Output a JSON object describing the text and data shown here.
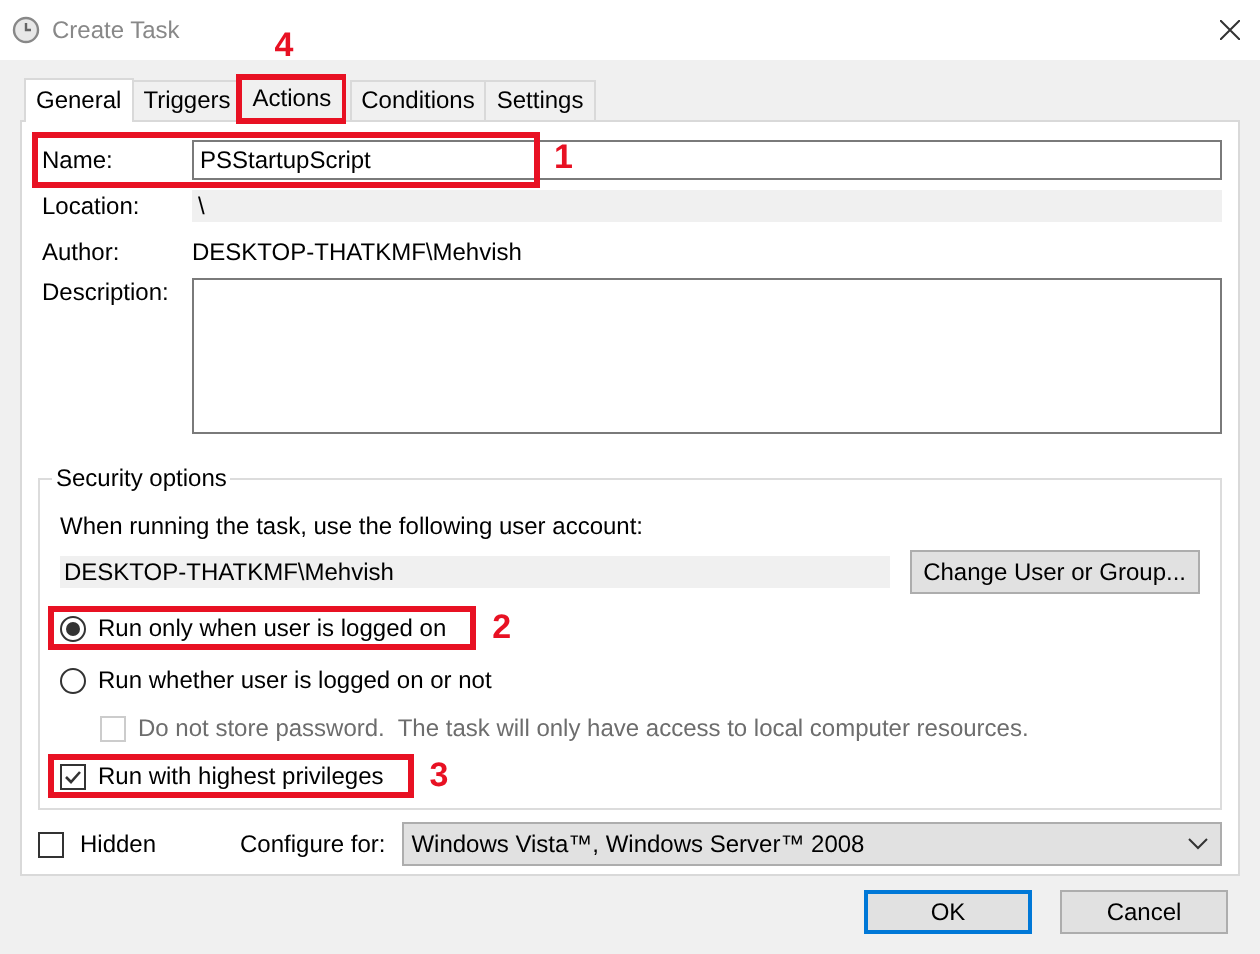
{
  "window": {
    "title": "Create Task"
  },
  "tabs": [
    {
      "label": "General",
      "selected": true
    },
    {
      "label": "Triggers",
      "selected": false
    },
    {
      "label": "Actions",
      "selected": false,
      "callout": "4"
    },
    {
      "label": "Conditions",
      "selected": false
    },
    {
      "label": "Settings",
      "selected": false
    }
  ],
  "general": {
    "name": {
      "label": "Name:",
      "value": "PSStartupScript",
      "callout": "1"
    },
    "location": {
      "label": "Location:",
      "value": "\\"
    },
    "author": {
      "label": "Author:",
      "value": "DESKTOP-THATKMF\\Mehvish"
    },
    "description": {
      "label": "Description:"
    }
  },
  "security": {
    "title": "Security options",
    "prompt": "When running the task, use the following user account:",
    "account": "DESKTOP-THATKMF\\Mehvish",
    "change_button": "Change User or Group...",
    "options": [
      {
        "kind": "radio",
        "label": "Run only when user is logged on",
        "selected": true,
        "callout": "2"
      },
      {
        "kind": "radio",
        "label": "Run whether user is logged on or not",
        "selected": false,
        "children": [
          {
            "kind": "checkbox",
            "label": "Do not store password.  The task will only have access to local computer resources.",
            "checked": false,
            "disabled": true
          }
        ]
      },
      {
        "kind": "checkbox",
        "label": "Run with highest privileges",
        "checked": true,
        "disabled": false,
        "callout": "3"
      }
    ]
  },
  "hidden": {
    "label": "Hidden",
    "checked": false
  },
  "configure": {
    "label": "Configure for:",
    "value": "Windows Vista™, Windows Server™ 2008"
  },
  "buttons": [
    {
      "label": "OK",
      "default": true
    },
    {
      "label": "Cancel",
      "default": false
    }
  ]
}
